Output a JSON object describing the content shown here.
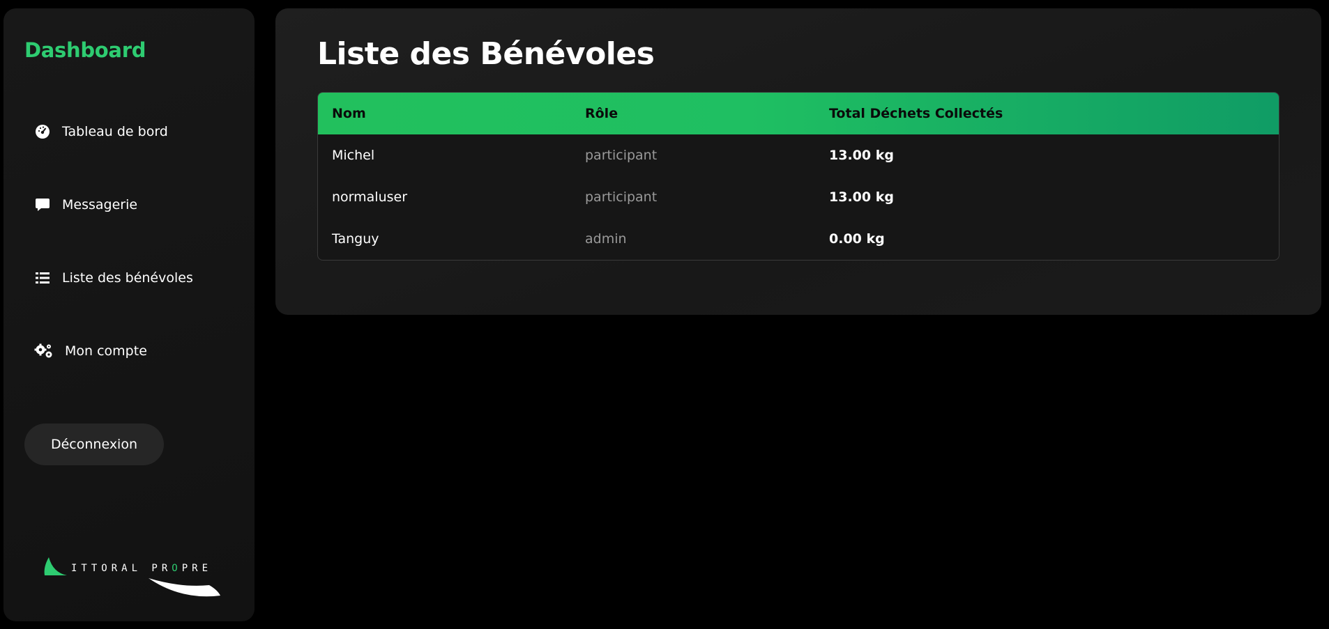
{
  "sidebar": {
    "title": "Dashboard",
    "items": [
      {
        "label": "Tableau de bord",
        "icon": "gauge-icon"
      },
      {
        "label": "Messagerie",
        "icon": "message-icon"
      },
      {
        "label": "Liste des bénévoles",
        "icon": "list-icon"
      },
      {
        "label": "Mon compte",
        "icon": "gears-icon"
      }
    ],
    "logout_label": "Déconnexion",
    "logo": {
      "text_prefix": "ITTORAL PR",
      "text_o": "O",
      "text_suffix": "PRE"
    }
  },
  "main": {
    "title": "Liste des Bénévoles",
    "table": {
      "headers": {
        "name": "Nom",
        "role": "Rôle",
        "total": "Total Déchets Collectés"
      },
      "rows": [
        {
          "name": "Michel",
          "role": "participant",
          "total": "13.00 kg"
        },
        {
          "name": "normaluser",
          "role": "participant",
          "total": "13.00 kg"
        },
        {
          "name": "Tanguy",
          "role": "admin",
          "total": "0.00 kg"
        }
      ]
    }
  },
  "colors": {
    "accent": "#2ecc71",
    "background": "#000000",
    "panel": "#1b1b1b"
  }
}
